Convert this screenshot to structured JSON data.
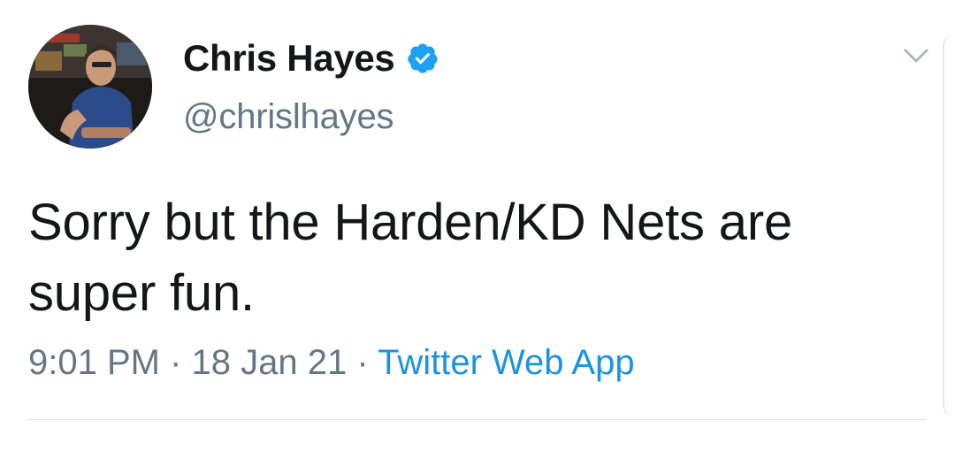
{
  "author": {
    "display_name": "Chris Hayes",
    "handle": "@chrislhayes",
    "verified": true
  },
  "tweet": {
    "text_line1": "Sorry but the Harden/KD Nets are",
    "text_line2": "super fun.",
    "time": "9:01 PM",
    "separator": "·",
    "date": "18 Jan 21",
    "source": "Twitter Web App"
  },
  "colors": {
    "text_primary": "#14171a",
    "text_secondary": "#657786",
    "link": "#1b95e0",
    "verified_badge": "#1da1f2",
    "divider": "#e1e8ed"
  },
  "icons": {
    "avatar": "profile-photo",
    "verified": "verified-badge-icon",
    "menu": "chevron-down-icon"
  }
}
